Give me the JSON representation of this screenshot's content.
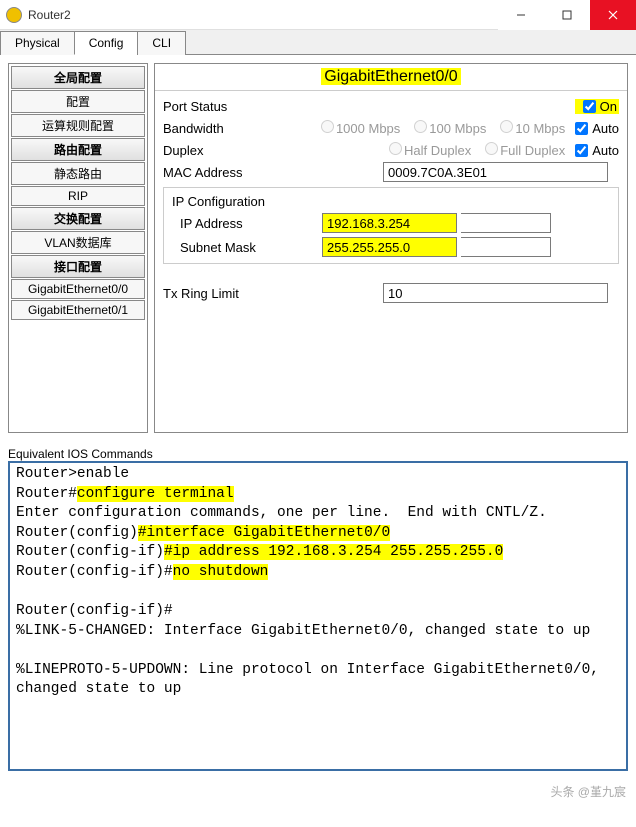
{
  "window": {
    "title": "Router2"
  },
  "tabs": [
    "Physical",
    "Config",
    "CLI"
  ],
  "active_tab": "Config",
  "sidebar": {
    "groups": [
      {
        "header": "全局配置",
        "items": [
          "配置",
          "运算规则配置"
        ]
      },
      {
        "header": "路由配置",
        "items": [
          "静态路由",
          "RIP"
        ]
      },
      {
        "header": "交换配置",
        "items": [
          "VLAN数据库"
        ]
      },
      {
        "header": "接口配置",
        "items": [
          "GigabitEthernet0/0",
          "GigabitEthernet0/1"
        ]
      }
    ]
  },
  "panel": {
    "title": "GigabitEthernet0/0",
    "port_status": {
      "label": "Port Status",
      "on_label": "On",
      "checked": true
    },
    "bandwidth": {
      "label": "Bandwidth",
      "options": [
        "1000 Mbps",
        "100 Mbps",
        "10 Mbps"
      ],
      "auto_label": "Auto",
      "auto_checked": true
    },
    "duplex": {
      "label": "Duplex",
      "options": [
        "Half Duplex",
        "Full Duplex"
      ],
      "auto_label": "Auto",
      "auto_checked": true
    },
    "mac": {
      "label": "MAC Address",
      "value": "0009.7C0A.3E01"
    },
    "ip_config": {
      "title": "IP Configuration",
      "ip": {
        "label": "IP Address",
        "value": "192.168.3.254"
      },
      "mask": {
        "label": "Subnet Mask",
        "value": "255.255.255.0"
      }
    },
    "tx": {
      "label": "Tx Ring Limit",
      "value": "10"
    }
  },
  "ios": {
    "label": "Equivalent IOS Commands",
    "lines": [
      {
        "t": "Router>enable",
        "hl": []
      },
      {
        "t": "Router#configure terminal",
        "hl": [
          [
            7,
            25
          ]
        ]
      },
      {
        "t": "Enter configuration commands, one per line.  End with CNTL/Z.",
        "hl": []
      },
      {
        "t": "Router(config)#interface GigabitEthernet0/0",
        "hl": [
          [
            14,
            44
          ]
        ]
      },
      {
        "t": "Router(config-if)#ip address 192.168.3.254 255.255.255.0",
        "hl": [
          [
            17,
            56
          ]
        ]
      },
      {
        "t": "Router(config-if)#no shutdown",
        "hl": [
          [
            18,
            29
          ]
        ]
      },
      {
        "t": "",
        "hl": []
      },
      {
        "t": "Router(config-if)#",
        "hl": []
      },
      {
        "t": "%LINK-5-CHANGED: Interface GigabitEthernet0/0, changed state to up",
        "hl": []
      },
      {
        "t": "",
        "hl": []
      },
      {
        "t": "%LINEPROTO-5-UPDOWN: Line protocol on Interface GigabitEthernet0/0, changed state to up",
        "hl": []
      }
    ]
  },
  "watermark": "头条 @堇九宸"
}
